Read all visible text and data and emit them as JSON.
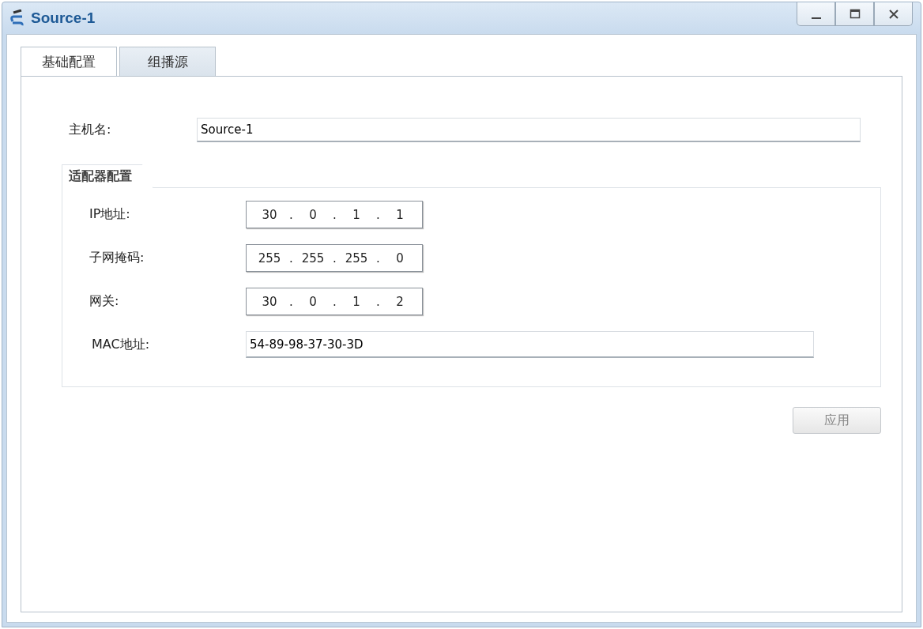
{
  "window": {
    "title": "Source-1"
  },
  "tabs": [
    {
      "label": "基础配置",
      "selected": true
    },
    {
      "label": "组播源",
      "selected": false
    }
  ],
  "hostname": {
    "label": "主机名:",
    "value": "Source-1"
  },
  "adapter": {
    "title": "适配器配置",
    "ip_fields": [
      {
        "label": "IP地址:",
        "octets": [
          "30",
          "0",
          "1",
          "1"
        ]
      },
      {
        "label": "子网掩码:",
        "octets": [
          "255",
          "255",
          "255",
          "0"
        ]
      },
      {
        "label": "网关:",
        "octets": [
          "30",
          "0",
          "1",
          "2"
        ]
      }
    ],
    "separator": ".",
    "mac": {
      "label": "MAC地址:",
      "value": "54-89-98-37-30-3D"
    }
  },
  "apply_button": {
    "label": "应用",
    "disabled": true
  }
}
